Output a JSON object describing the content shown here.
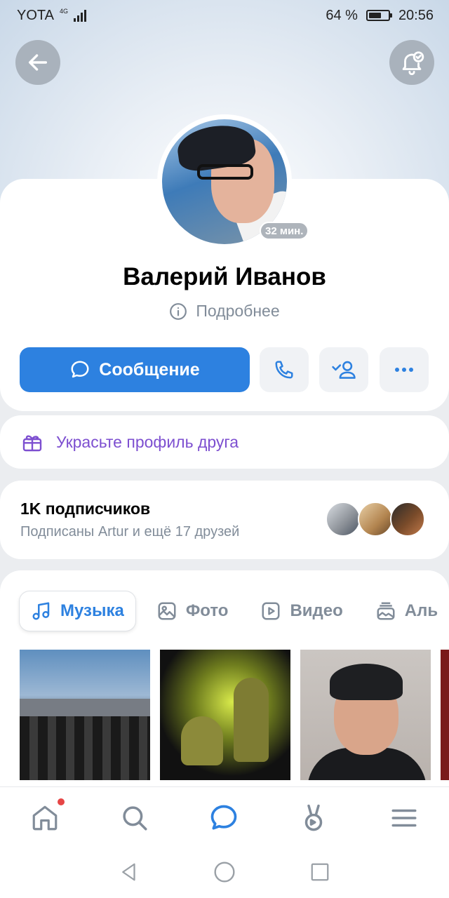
{
  "status_bar": {
    "carrier": "YOTA",
    "network": "4G",
    "battery_percent": "64 %",
    "battery_level": 0.64,
    "time": "20:56"
  },
  "profile": {
    "name": "Валерий Иванов",
    "last_seen": "32 мин.",
    "details_label": "Подробнее",
    "message_button": "Сообщение",
    "decorate_label": "Украсьте профиль друга"
  },
  "followers": {
    "count_label": "1K подписчиков",
    "friends_label": "Подписаны Artur и ещё 17 друзей"
  },
  "media_tabs": [
    {
      "label": "Музыка",
      "icon": "music-note-icon",
      "active": true
    },
    {
      "label": "Фото",
      "icon": "photo-icon",
      "active": false
    },
    {
      "label": "Видео",
      "icon": "video-icon",
      "active": false
    },
    {
      "label": "Аль",
      "icon": "album-icon",
      "active": false
    }
  ],
  "bottom_nav": {
    "items": [
      "home-icon",
      "search-icon",
      "messenger-icon",
      "clips-icon",
      "menu-icon"
    ],
    "active": "messenger-icon",
    "notification_on": "home-icon"
  },
  "colors": {
    "accent": "#2d81e0",
    "purple": "#7d4fd0",
    "secondary_text": "#818c99",
    "notification": "#e64646"
  }
}
